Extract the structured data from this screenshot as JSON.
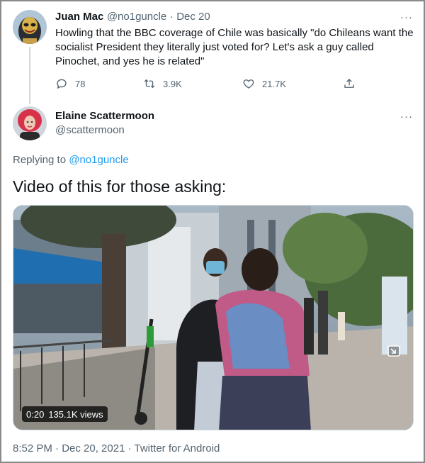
{
  "parent_tweet": {
    "display_name": "Juan Mac",
    "handle": "@no1guncle",
    "separator": "·",
    "date": "Dec 20",
    "more_label": "···",
    "text_lines": [
      "Howling that the BBC coverage of Chile was basically \"do Chileans want the",
      "socialist President they literally just voted for? Let's ask a guy called",
      "Pinochet, and yes he is related\""
    ],
    "replies": "78",
    "retweets": "3.9K",
    "likes": "21.7K",
    "icons": [
      "reply-icon",
      "retweet-icon",
      "like-icon",
      "share-icon"
    ]
  },
  "reply_tweet": {
    "display_name": "Elaine Scattermoon",
    "handle": "@scattermoon",
    "more_label": "···",
    "replying_to_prefix": "Replying to ",
    "replying_to_handle": "@no1guncle",
    "text": "Video of this for those asking:",
    "video": {
      "time": "0:20",
      "views": "135.1K views"
    },
    "timestamp": "8:52 PM · Dec 20, 2021 · Twitter for Android"
  },
  "colors": {
    "accent": "#1d9bf0",
    "muted": "#536471",
    "text": "#0f1419"
  }
}
